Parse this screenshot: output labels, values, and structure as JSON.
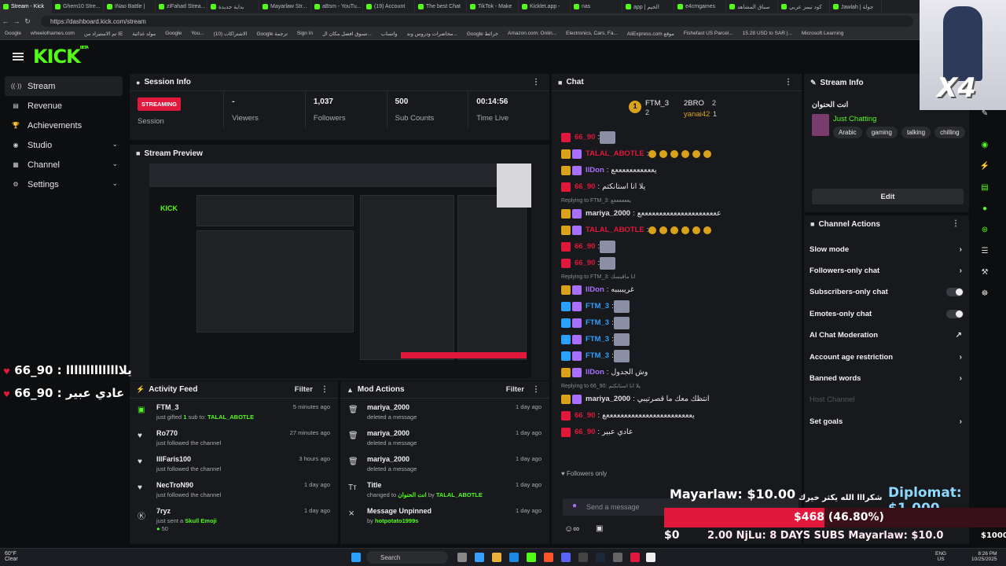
{
  "browser": {
    "tabs": [
      "Stream - Kick",
      "Ghem10 Stre...",
      "INao Battle |",
      "ziFahad Strea...",
      "بداية جديدة",
      "Mayarlaw Str...",
      "aBsm - YouTu...",
      "(19) Account",
      "The best Chat",
      "TikTok - Make",
      "Kicklet.app -",
      "nas",
      "app | الخيم",
      "e4cmgames",
      "سباق المشاهد",
      "كود نيمز عربي",
      "Jawlah | جولة"
    ],
    "url": "https://dashboard.kick.com/stream",
    "bookmarks": [
      "Google",
      "wheelofnames.com",
      "تم الاستيراد من IE",
      "مولد غذائية",
      "Google",
      "You...",
      "الاشتراكات (10)",
      "Google ترجمة",
      "Sign In",
      "تسوق افضل مكان ال...",
      "واتساب",
      "محاضرات ودروس وند...",
      "Google خرائط",
      "Amazon.com: Onlin...",
      "Electronics, Cars, Fa...",
      "AliExpress.com موقع",
      "Fishefast US Parcel...",
      "15.28 USD to SAR |...",
      "Microsoft Learning"
    ]
  },
  "brand": {
    "logo": "KICK",
    "beta": "BETA"
  },
  "sidebar": {
    "items": [
      {
        "label": "Stream",
        "icon": "stream-icon"
      },
      {
        "label": "Revenue",
        "icon": "revenue-icon"
      },
      {
        "label": "Achievements",
        "icon": "trophy-icon"
      },
      {
        "label": "Studio",
        "icon": "studio-icon"
      },
      {
        "label": "Channel",
        "icon": "channel-icon"
      },
      {
        "label": "Settings",
        "icon": "gear-icon"
      }
    ]
  },
  "session": {
    "title": "Session Info",
    "status": "STREAMING",
    "status_label": "Session",
    "viewers": "-",
    "viewers_label": "Viewers",
    "followers": "1,037",
    "followers_label": "Followers",
    "subs": "500",
    "subs_label": "Sub Counts",
    "time": "00:14:56",
    "time_label": "Time Live"
  },
  "preview": {
    "title": "Stream Preview",
    "overlay1_name": "66_90",
    "overlay1_msg": "يلاااااااااااااا",
    "overlay2_name": "66_90",
    "overlay2_msg": "عادي عبير"
  },
  "activity": {
    "title": "Activity Feed",
    "filter": "Filter",
    "items": [
      {
        "name": "FTM_3",
        "sub": "just gifted ",
        "sub_green": "1",
        "sub2": " sub to: ",
        "sub_green2": "TALAL_ABOTLE",
        "time": "5 minutes ago"
      },
      {
        "name": "Ro770",
        "sub": "just followed the channel",
        "time": "27 minutes ago"
      },
      {
        "name": "IllFaris100",
        "sub": "just followed the channel",
        "time": "3 hours ago"
      },
      {
        "name": "NecTroN90",
        "sub": "just followed the channel",
        "time": "1 day ago"
      },
      {
        "name": "7ryz",
        "sub": "just sent a ",
        "sub_green": "Skull Emoji",
        "time": "1 day ago",
        "amount": "50"
      }
    ]
  },
  "mod": {
    "title": "Mod Actions",
    "filter": "Filter",
    "items": [
      {
        "name": "mariya_2000",
        "sub": "deleted a message",
        "time": "1 day ago"
      },
      {
        "name": "mariya_2000",
        "sub": "deleted a message",
        "time": "1 day ago"
      },
      {
        "name": "mariya_2000",
        "sub": "deleted a message",
        "time": "1 day ago"
      },
      {
        "name": "Title",
        "sub": "changed to ",
        "sub_green": "انت الحنوان",
        "sub2": " by ",
        "sub_green2": "TALAL_ABOTLE",
        "time": "1 day ago"
      },
      {
        "name": "Message Unpinned",
        "sub": "by ",
        "sub_green": "hotpotato1999s",
        "time": "1 day ago"
      }
    ]
  },
  "chat": {
    "title": "Chat",
    "top1_name": "FTM_3",
    "top1_count": "2",
    "top2_name": "2BRO",
    "top2_count": "2",
    "top3_name": "yanai42",
    "top3_count": "1",
    "placeholder": "Send a message",
    "followers_only": "Followers only",
    "messages": [
      {
        "u": "66_90",
        "color": "#e0183c",
        "t": ""
      },
      {
        "u": "TALAL_ABOTLE",
        "color": "#e0183c",
        "t": ""
      },
      {
        "u": "llDon",
        "color": "#a970ff",
        "t": "يعععععععععععع"
      },
      {
        "u": "66_90",
        "color": "#e0183c",
        "t": "يلا انا استانكتم"
      },
      {
        "reply": "Replying to FTM_3: يععععععع"
      },
      {
        "u": "mariya_2000",
        "color": "#e0e0e0",
        "t": "ععععععععععععععععععععععع"
      },
      {
        "u": "TALAL_ABOTLE",
        "color": "#e0183c",
        "t": ""
      },
      {
        "u": "66_90",
        "color": "#e0183c",
        "t": ""
      },
      {
        "u": "66_90",
        "color": "#e0183c",
        "t": ""
      },
      {
        "reply": "Replying to FTM_3: انا ماقيسك"
      },
      {
        "u": "llDon",
        "color": "#a970ff",
        "t": "غريببببه"
      },
      {
        "u": "FTM_3",
        "color": "#2aa0ff",
        "t": ""
      },
      {
        "u": "FTM_3",
        "color": "#2aa0ff",
        "t": ""
      },
      {
        "u": "FTM_3",
        "color": "#2aa0ff",
        "t": ""
      },
      {
        "u": "FTM_3",
        "color": "#2aa0ff",
        "t": ""
      },
      {
        "u": "llDon",
        "color": "#a970ff",
        "t": "وش الجدول"
      },
      {
        "reply": "Replying to 66_90: يلا انا استانكتم"
      },
      {
        "u": "mariya_2000",
        "color": "#e0e0e0",
        "t": "انتظك معك ما قصرتيبي"
      },
      {
        "u": "66_90",
        "color": "#e0183c",
        "t": "يععععععععععععععععععععععععع"
      },
      {
        "u": "66_90",
        "color": "#e0183c",
        "t": "عادي عبير"
      }
    ]
  },
  "streaminfo": {
    "title": "Stream Info",
    "stream_title": "انت الحنوان",
    "category": "Just Chatting",
    "tags": [
      "Arabic",
      "gaming",
      "talking",
      "chilling"
    ],
    "edit": "Edit"
  },
  "channel_actions": {
    "title": "Channel Actions",
    "items": [
      {
        "label": "Slow mode",
        "kind": "arrow"
      },
      {
        "label": "Followers-only chat",
        "kind": "arrow"
      },
      {
        "label": "Subscribers-only chat",
        "kind": "toggle"
      },
      {
        "label": "Emotes-only chat",
        "kind": "toggle"
      },
      {
        "label": "AI Chat Moderation",
        "kind": "ext"
      },
      {
        "label": "Account age restriction",
        "kind": "arrow"
      },
      {
        "label": "Banned words",
        "kind": "arrow"
      },
      {
        "label": "Host Channel",
        "kind": "disabled"
      },
      {
        "label": "Set goals",
        "kind": "arrow"
      }
    ]
  },
  "overlay": {
    "x4": "X4",
    "donation1": "Mayarlaw: $10.00",
    "donation2": "Diplomat: $1,000",
    "arabic_thanks": "شكرااا الله يكثر خيرك",
    "goal_amount": "$468",
    "goal_pct": "(46.80%)",
    "goal_fraction": 0.468,
    "goal_start": "$0",
    "ticker": "2.00   NjLu:   8 DAYS SUBS   Mayarlaw: $10.00   N",
    "goal_end": "$1000"
  },
  "taskbar": {
    "search": "Search",
    "lang1": "ENG",
    "lang2": "US",
    "time": "8:26 PM",
    "date": "10/25/2025",
    "weather": "60°F",
    "weather_sub": "Clear"
  },
  "colors": {
    "accent": "#53fc18",
    "live": "#e0183c",
    "panel": "#18191c"
  }
}
